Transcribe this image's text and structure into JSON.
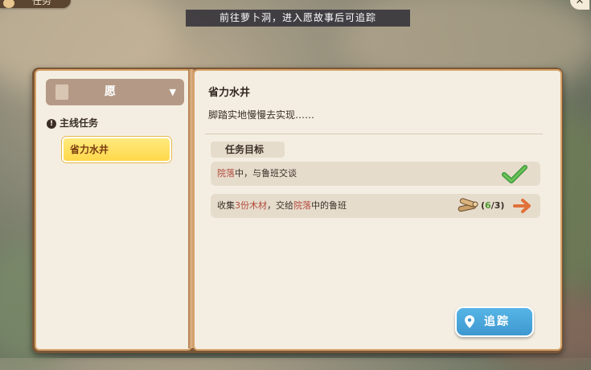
{
  "window": {
    "tab_label": "任务",
    "close_symbol": "✕"
  },
  "hint_banner": "前往萝卜洞，进入愿故事后可追踪",
  "sidebar": {
    "dropdown_label": "愿",
    "dropdown_arrow": "▼",
    "section_title": "主线任务",
    "warning_symbol": "!",
    "quests": [
      {
        "label": "省力水井",
        "selected": true
      }
    ]
  },
  "detail": {
    "title": "省力水井",
    "description": "脚踏实地慢慢去实现……",
    "objectives_header": "任务目标",
    "objectives": [
      {
        "place": "院落",
        "text_after_place": "中，与鲁班交谈",
        "status": "completed"
      },
      {
        "text_before_count": "收集",
        "count_text": "3份木材",
        "text_mid": "，交给",
        "place": "院落",
        "text_after_place": "中的鲁班",
        "progress_open": "(",
        "progress_current": "6",
        "progress_total": "/3)",
        "status": "in_progress",
        "item_icon": "wood-icon"
      }
    ],
    "track_button_label": "追踪"
  },
  "colors": {
    "highlight_text": "#b2493c",
    "progress_green": "#4d9b2e",
    "selected_quest_bg": "#ffd84a",
    "track_button": "#3d98cf"
  }
}
